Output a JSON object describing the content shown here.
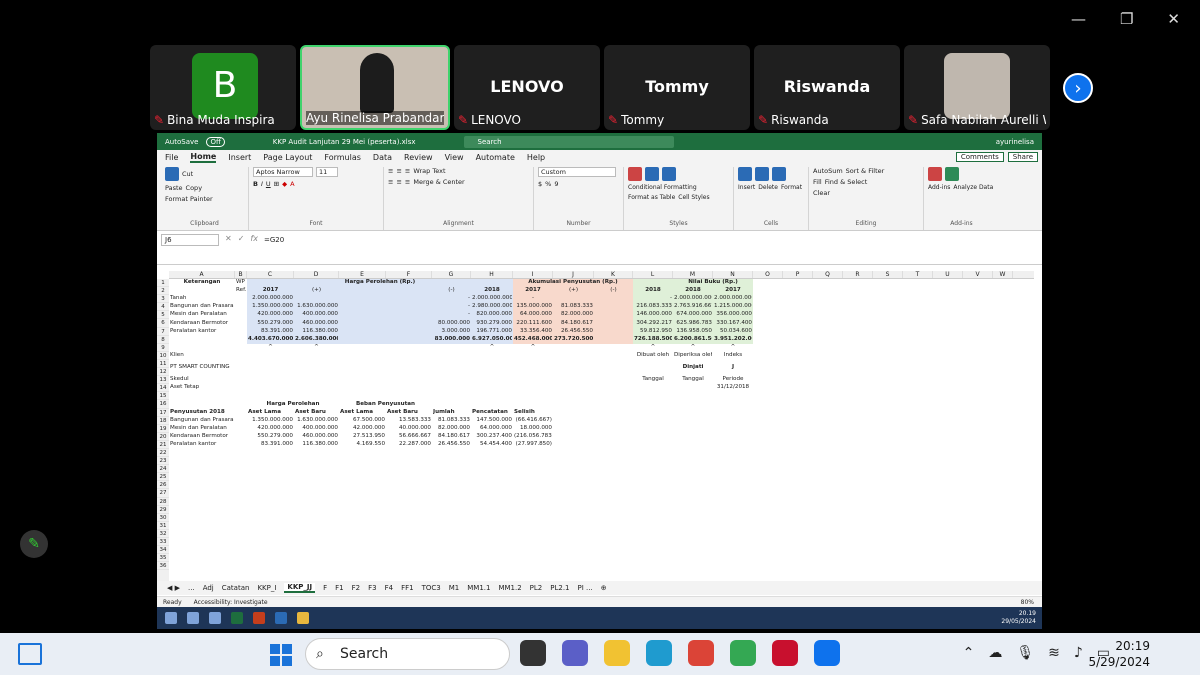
{
  "window": {
    "restore": "❐",
    "minimize": "—",
    "close": "✕"
  },
  "participants": [
    {
      "name": "Bina Muda Inspira",
      "initial": "B",
      "type": "avatar"
    },
    {
      "name": "Ayu Rinelisa Prabandari",
      "type": "video",
      "active": true
    },
    {
      "name": "LENOVO",
      "big": "LENOVO",
      "type": "text"
    },
    {
      "name": "Tommy",
      "big": "Tommy",
      "type": "text"
    },
    {
      "name": "Riswanda",
      "big": "Riswanda",
      "type": "text"
    },
    {
      "name": "Safa Nabilah Aurelli W...",
      "type": "video2"
    }
  ],
  "excel": {
    "autosave": "AutoSave",
    "autosave_state": "Off",
    "title": "KKP Audit Lanjutan 29 Mei (peserta).xlsx",
    "search": "Search",
    "user": "ayurinelisa",
    "menu": [
      "File",
      "Home",
      "Insert",
      "Page Layout",
      "Formulas",
      "Data",
      "Review",
      "View",
      "Automate",
      "Help"
    ],
    "comments": "Comments",
    "share": "Share",
    "ribbon": {
      "clipboard": {
        "label": "Clipboard",
        "paste": "Paste",
        "cut": "Cut",
        "copy": "Copy",
        "painter": "Format Painter"
      },
      "font": {
        "label": "Font",
        "name": "Aptos Narrow",
        "size": "11"
      },
      "alignment": {
        "label": "Alignment",
        "wrap": "Wrap Text",
        "merge": "Merge & Center"
      },
      "number": {
        "label": "Number",
        "format": "Custom"
      },
      "styles": {
        "label": "Styles",
        "cond": "Conditional Formatting",
        "table": "Format as Table",
        "cell": "Cell Styles"
      },
      "cells": {
        "label": "Cells",
        "insert": "Insert",
        "delete": "Delete",
        "format": "Format"
      },
      "editing": {
        "label": "Editing",
        "autosum": "AutoSum",
        "fill": "Fill",
        "clear": "Clear",
        "sort": "Sort & Filter",
        "find": "Find & Select"
      },
      "addins": {
        "label": "Add-ins",
        "addins": "Add-ins",
        "analyze": "Analyze Data"
      }
    },
    "namebox": "J6",
    "formula": "=G20",
    "columns": [
      "A",
      "B",
      "C",
      "D",
      "E",
      "F",
      "G",
      "H",
      "I",
      "J",
      "K",
      "L",
      "M",
      "N",
      "O",
      "P",
      "Q",
      "R",
      "S",
      "T",
      "U",
      "V",
      "W"
    ],
    "rows": [
      "1",
      "2",
      "3",
      "4",
      "5",
      "6",
      "7",
      "8",
      "9",
      "10",
      "11",
      "12",
      "13",
      "14",
      "15",
      "16",
      "17",
      "18",
      "19",
      "20",
      "21",
      "22",
      "23",
      "24",
      "25",
      "26",
      "27",
      "28",
      "29",
      "30",
      "31",
      "32",
      "33",
      "34",
      "35",
      "36"
    ],
    "cells": {
      "keterangan": "Keterangan",
      "wp": "WP",
      "ref": "Ref.",
      "hp": "Harga Perolehan (Rp.)",
      "ap": "Akumulasi Penyusutan (Rp.)",
      "nb": "Nilai Buku (Rp.)",
      "y2017": "2017",
      "plus": "(+)",
      "minus": "(-)",
      "y2018": "2018",
      "r3": [
        "Tanah",
        "2.000.000.000",
        "-",
        "2.000.000.000",
        "-",
        "-",
        "2.000.000.000",
        "2.000.000.000"
      ],
      "r4": [
        "Bangunan dan Prasarana",
        "1.350.000.000",
        "1.630.000.000",
        "-",
        "2.980.000.000",
        "135.000.000",
        "81.083.333",
        "216.083.333",
        "2.763.916.667",
        "1.215.000.000"
      ],
      "r5": [
        "Mesin dan Peralatan",
        "420.000.000",
        "400.000.000",
        "-",
        "820.000.000",
        "64.000.000",
        "82.000.000",
        "146.000.000",
        "674.000.000",
        "356.000.000"
      ],
      "r6": [
        "Kendaraan Bermotor",
        "550.279.000",
        "460.000.000",
        "80.000.000",
        "930.279.000",
        "220.111.600",
        "84.180.617",
        "304.292.217",
        "625.986.783",
        "330.167.400"
      ],
      "r7": [
        "Peralatan kantor",
        "83.391.000",
        "116.380.000",
        "3.000.000",
        "196.771.000",
        "33.356.400",
        "26.456.550",
        "59.812.950",
        "136.958.050",
        "50.034.600"
      ],
      "r8": [
        "4.403.670.000",
        "2.606.380.000",
        "83.000.000",
        "6.927.050.000",
        "452.468.000",
        "273.720.500",
        "726.188.500",
        "6.200.861.500",
        "3.951.202.000"
      ],
      "caret": "^",
      "klien": "Klien",
      "dibuat": "Dibuat oleh",
      "diperiksa": "Diperiksa oleh",
      "indeks": "Indeks",
      "pt": "PT SMART COUNTING",
      "dinjati": "Dinjati",
      "j": "J",
      "skedul": "Skedul",
      "tanggal": "Tanggal",
      "periode": "Periode",
      "aset": "Aset Tetap",
      "tgl": "31/12/2018",
      "hp2": "Harga Perolehan",
      "bp": "Beban Penyusutan",
      "peny": "Penyusutan 2018",
      "al": "Aset Lama",
      "ab": "Aset Baru",
      "jumlah": "Jumlah",
      "pencatatan": "Pencatatan",
      "selisih": "Selisih",
      "r18": [
        "Bangunan dan Prasarana",
        "1.350.000.000",
        "1.630.000.000",
        "67.500.000",
        "13.583.333",
        "81.083.333",
        "147.500.000",
        "(66.416.667)"
      ],
      "r19": [
        "Mesin dan Peralatan",
        "420.000.000",
        "400.000.000",
        "42.000.000",
        "40.000.000",
        "82.000.000",
        "64.000.000",
        "18.000.000"
      ],
      "r20": [
        "Kendaraan Bermotor",
        "550.279.000",
        "460.000.000",
        "27.513.950",
        "56.666.667",
        "84.180.617",
        "300.237.400",
        "(216.056.783)"
      ],
      "r21": [
        "Peralatan kantor",
        "83.391.000",
        "116.380.000",
        "4.169.550",
        "22.287.000",
        "26.456.550",
        "54.454.400",
        "(27.997.850)"
      ]
    },
    "sheets": [
      "...",
      "Adj",
      "Catatan",
      "KKP_I",
      "KKP_JJ",
      "F",
      "F1",
      "F2",
      "F3",
      "F4",
      "FF1",
      "TOC3",
      "M1",
      "MM1.1",
      "MM1.2",
      "PL2",
      "PL2.1",
      "PI ..."
    ],
    "active_sheet": "KKP_JJ",
    "status": {
      "ready": "Ready",
      "access": "Accessibility: Investigate",
      "zoom": "80%"
    }
  },
  "zoom_taskbar": {
    "time": "20.19",
    "date": "29/05/2024"
  },
  "taskbar": {
    "search": "Search",
    "time": "20:19",
    "date": "5/29/2024"
  }
}
